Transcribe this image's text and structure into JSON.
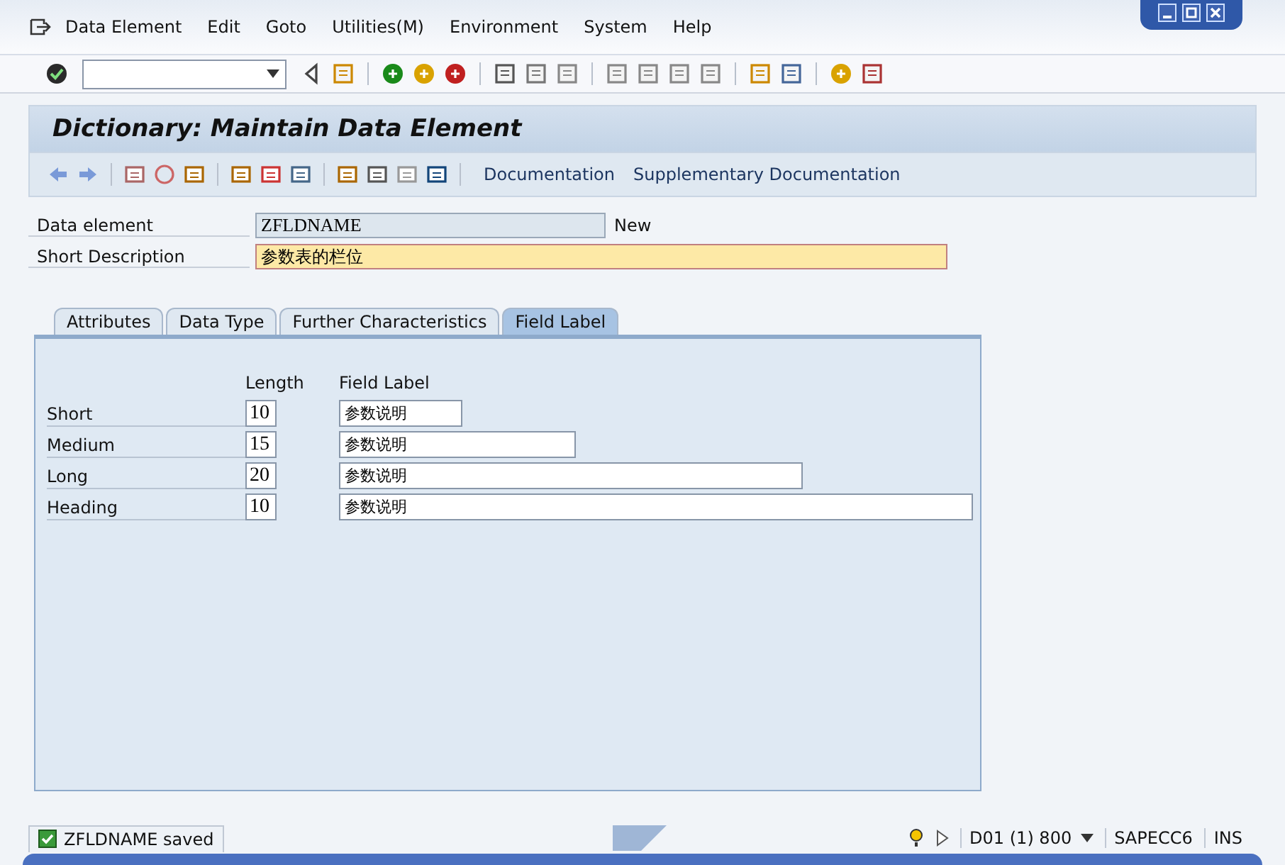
{
  "menu": [
    "Data Element",
    "Edit",
    "Goto",
    "Utilities(M)",
    "Environment",
    "System",
    "Help"
  ],
  "title": "Dictionary: Maintain Data Element",
  "app_toolbar": {
    "links": [
      "Documentation",
      "Supplementary Documentation"
    ]
  },
  "header_fields": [
    {
      "label": "Data element",
      "value": "ZFLDNAME",
      "status": "New",
      "kind": "display"
    },
    {
      "label": "Short Description",
      "value": "参数表的栏位",
      "kind": "required"
    }
  ],
  "tabs": [
    {
      "label": "Attributes",
      "selected": false
    },
    {
      "label": "Data Type",
      "selected": false
    },
    {
      "label": "Further Characteristics",
      "selected": false
    },
    {
      "label": "Field Label",
      "selected": true
    }
  ],
  "field_labels": {
    "columns": [
      "Length",
      "Field Label"
    ],
    "rows": [
      {
        "name": "Short",
        "length": "10",
        "label": "参数说明"
      },
      {
        "name": "Medium",
        "length": "15",
        "label": "参数说明"
      },
      {
        "name": "Long",
        "length": "20",
        "label": "参数说明"
      },
      {
        "name": "Heading",
        "length": "10",
        "label": "参数说明"
      }
    ]
  },
  "status_bar": {
    "message": "ZFLDNAME saved",
    "system": "D01 (1) 800",
    "server": "SAPECC6",
    "mode": "INS"
  }
}
